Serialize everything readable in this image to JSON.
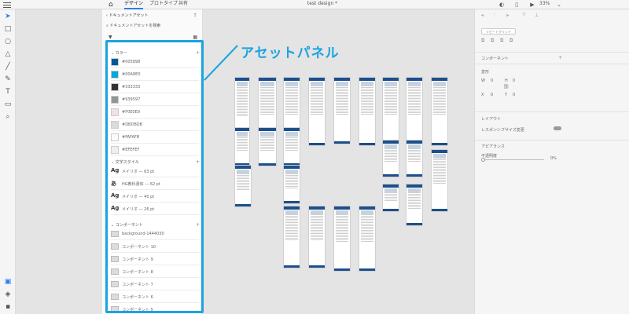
{
  "topbar": {
    "tabs": [
      {
        "label": "デザイン",
        "active": true
      },
      {
        "label": "プロトタイプ",
        "active": false
      },
      {
        "label": "共有",
        "active": false
      }
    ],
    "doc_title": "test design *",
    "zoom": "33%"
  },
  "assets": {
    "back_label": "ドキュメントアセット",
    "search_placeholder": "ドキュメントアセットを検索",
    "colors_heading": "カラー",
    "colors": [
      {
        "hex": "#005898",
        "label": "#005898"
      },
      {
        "hex": "#00A8E0",
        "label": "#00A8E0"
      },
      {
        "hex": "#333333",
        "label": "#333333"
      },
      {
        "hex": "#939597",
        "label": "#939597"
      },
      {
        "hex": "#F0E0E9",
        "label": "#F0E0E9"
      },
      {
        "hex": "#DBDBDB",
        "label": "#DBDBDB"
      },
      {
        "hex": "#FAFAFB",
        "label": "#FAFAFB"
      },
      {
        "hex": "#EFEFEF",
        "label": "#EFEFEF"
      }
    ],
    "char_styles_heading": "文字スタイル",
    "char_styles": [
      {
        "glyph": "Ag",
        "label": "メイリオ — 63 pt"
      },
      {
        "glyph": "あ",
        "label": "HG教科書体 — 62 pt"
      },
      {
        "glyph": "Ag",
        "label": "メイリオ — 40 pt"
      },
      {
        "glyph": "Ag",
        "label": "メイリオ — 26 pt"
      }
    ],
    "components_heading": "コンポーネント",
    "components": [
      "background-1444030",
      "コンポーネント 10",
      "コンポーネント 9",
      "コンポーネント 8",
      "コンポーネント 7",
      "コンポーネント 6",
      "コンポーネント 5"
    ]
  },
  "callout": "アセットパネル",
  "props": {
    "repeat_grid": "リピートグリッド",
    "component": "コンポーネント",
    "transform": "変形",
    "w_label": "W",
    "w_value": "0",
    "h_label": "H",
    "h_value": "0",
    "x_label": "X",
    "x_value": "0",
    "y_label": "Y",
    "y_value": "0",
    "layout": "レイアウト",
    "responsive_resize": "レスポンシブサイズ変更",
    "appearance": "アピアランス",
    "opacity_label": "不透明度",
    "opacity_value": "0%"
  }
}
